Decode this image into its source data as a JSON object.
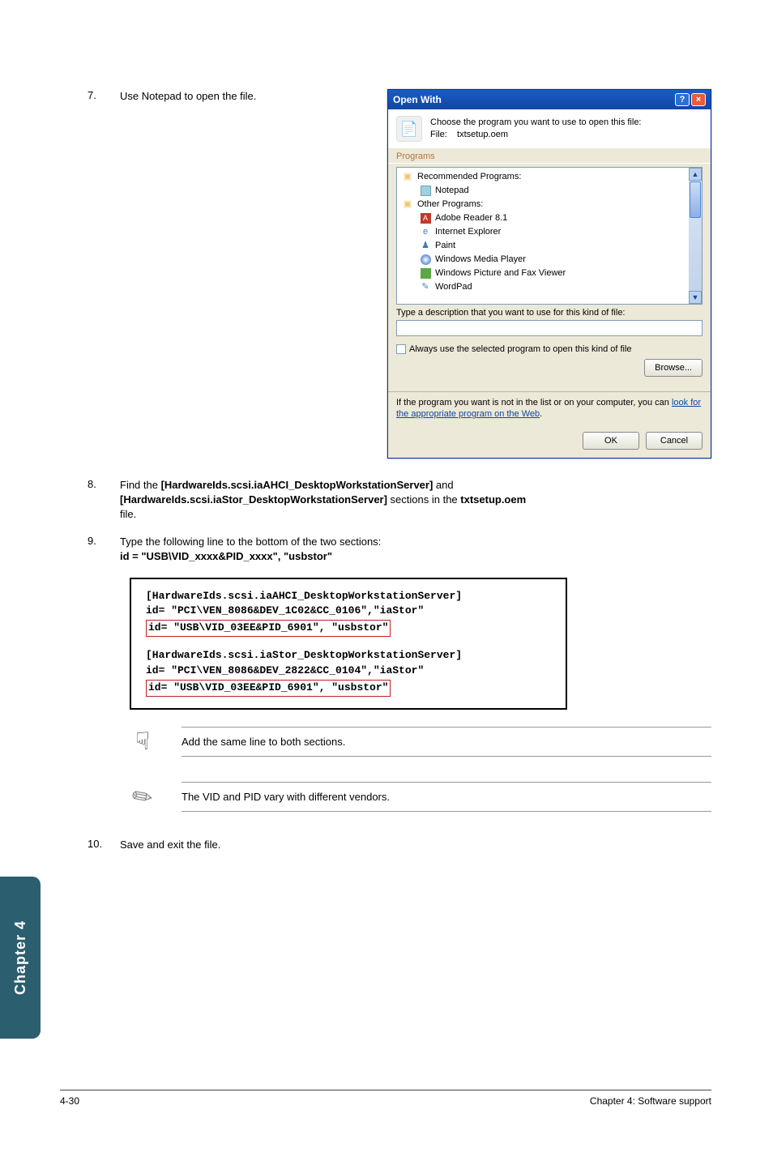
{
  "steps": {
    "s7_num": "7.",
    "s7_text": "Use Notepad to open the file.",
    "s8_num": "8.",
    "s8_a": "Find the ",
    "s8_b": "[HardwareIds.scsi.iaAHCI_DesktopWorkstationServer]",
    "s8_c": " and ",
    "s8_d": "[HardwareIds.scsi.iaStor_DesktopWorkstationServer]",
    "s8_e": " sections in the ",
    "s8_f": "txtsetup.oem",
    "s8_g": " file.",
    "s9_num": "9.",
    "s9_a": "Type the following line to the bottom of the two sections:",
    "s9_b": "id = \"USB\\VID_xxxx&PID_xxxx\", \"usbstor\"",
    "s10_num": "10.",
    "s10_text": "Save and exit the file."
  },
  "dialog": {
    "title": "Open With",
    "help": "?",
    "close": "×",
    "choose": "Choose the program you want to use to open this file:",
    "file_label": "File:",
    "file_name": "txtsetup.oem",
    "programs_tab": "Programs",
    "rec": "Recommended Programs:",
    "notepad": "Notepad",
    "other": "Other Programs:",
    "adobe": "Adobe Reader 8.1",
    "ie": "Internet Explorer",
    "paint": "Paint",
    "wmp": "Windows Media Player",
    "wpf": "Windows Picture and Fax Viewer",
    "wordpad": "WordPad",
    "up": "▲",
    "down": "▼",
    "type_label": "Type a description that you want to use for this kind of file:",
    "always": "Always use the selected program to open this kind of file",
    "browse": "Browse...",
    "look_a": "If the program you want is not in the list or on your computer, you can ",
    "look_link": "look for the appropriate program on the Web",
    "look_dot": ".",
    "ok": "OK",
    "cancel": "Cancel"
  },
  "code": {
    "l1": "[HardwareIds.scsi.iaAHCI_DesktopWorkstationServer]",
    "l2": "id= \"PCI\\VEN_8086&DEV_1C02&CC_0106\",\"iaStor\"",
    "l3": "id= \"USB\\VID_03EE&PID_6901\", \"usbstor\"",
    "l4": "[HardwareIds.scsi.iaStor_DesktopWorkstationServer]",
    "l5": "id= \"PCI\\VEN_8086&DEV_2822&CC_0104\",\"iaStor\"",
    "l6": "id= \"USB\\VID_03EE&PID_6901\", \"usbstor\""
  },
  "notes": {
    "n1": "Add the same line to both sections.",
    "n2": "The VID and PID vary with different vendors."
  },
  "side_tab": "Chapter 4",
  "footer": {
    "left": "4-30",
    "right": "Chapter 4: Software support"
  },
  "icons": {
    "hand": "☟",
    "pencil": "✎",
    "file": "📄"
  }
}
